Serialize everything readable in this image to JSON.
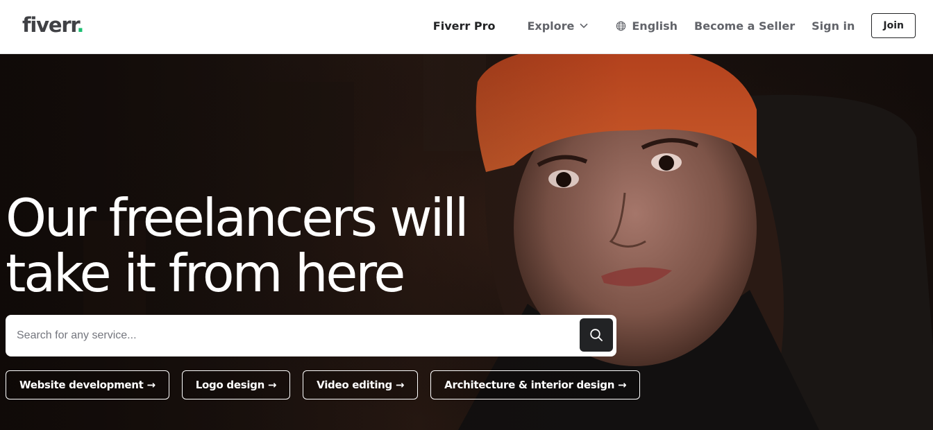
{
  "header": {
    "logo": "fiverr",
    "logo_dot": ".",
    "nav": {
      "fiverr_pro": "Fiverr Pro",
      "explore": "Explore",
      "language": "English",
      "become_seller": "Become a Seller",
      "sign_in": "Sign in",
      "join": "Join"
    }
  },
  "hero": {
    "title_line1": "Our freelancers will",
    "title_line2": "take it from here",
    "search": {
      "placeholder": "Search for any service...",
      "value": ""
    },
    "chips": [
      {
        "label": "Website development →"
      },
      {
        "label": "Logo design →"
      },
      {
        "label": "Video editing →"
      },
      {
        "label": "Architecture & interior design →"
      }
    ]
  },
  "colors": {
    "brand_green": "#1dbf73",
    "text_dark": "#222325",
    "text_gray": "#62646a",
    "beanie_orange": "#c4461e"
  },
  "icons": [
    "globe-icon",
    "chevron-down-icon",
    "search-icon"
  ]
}
